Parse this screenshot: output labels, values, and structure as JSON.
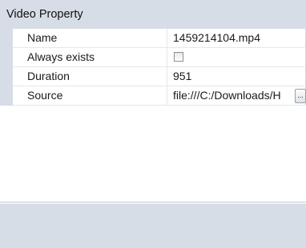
{
  "group": {
    "title": "Video Property"
  },
  "properties": [
    {
      "label": "Name",
      "value": "1459214104.mp4"
    },
    {
      "label": "Always exists",
      "value": "",
      "checked": false
    },
    {
      "label": "Duration",
      "value": "951"
    },
    {
      "label": "Source",
      "value": "file:///C:/Downloads/H",
      "button_label": "..."
    }
  ],
  "colors": {
    "header_bg": "#d6dde7",
    "grid_line": "#e3e7ec",
    "panel_bg": "#ffffff"
  }
}
